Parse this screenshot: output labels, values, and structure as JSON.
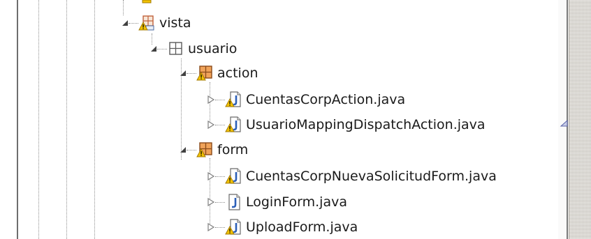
{
  "tree": {
    "nodes": [
      {
        "label": "vista",
        "kind": "package-folder",
        "expanded": true,
        "warning": true,
        "icon": "package-folder-warning-icon"
      },
      {
        "label": "usuario",
        "kind": "package",
        "expanded": true,
        "warning": false,
        "icon": "package-icon"
      },
      {
        "label": "action",
        "kind": "package",
        "expanded": true,
        "warning": true,
        "icon": "package-warning-icon"
      },
      {
        "label": "CuentasCorpAction.java",
        "kind": "java-file",
        "expanded": false,
        "warning": true,
        "icon": "java-file-warning-icon"
      },
      {
        "label": "UsuarioMappingDispatchAction.java",
        "kind": "java-file",
        "expanded": false,
        "warning": true,
        "icon": "java-file-warning-icon"
      },
      {
        "label": "form",
        "kind": "package",
        "expanded": true,
        "warning": true,
        "icon": "package-warning-icon"
      },
      {
        "label": "CuentasCorpNuevaSolicitudForm.java",
        "kind": "java-file",
        "expanded": false,
        "warning": true,
        "icon": "java-file-warning-icon"
      },
      {
        "label": "LoginForm.java",
        "kind": "java-file",
        "expanded": false,
        "warning": false,
        "icon": "java-file-icon"
      },
      {
        "label": "UploadForm.java",
        "kind": "java-file",
        "expanded": false,
        "warning": true,
        "icon": "java-file-warning-icon"
      }
    ]
  },
  "colors": {
    "warning": "#f2c200",
    "package": "#c0603a",
    "java_blue": "#2c5fb8"
  }
}
